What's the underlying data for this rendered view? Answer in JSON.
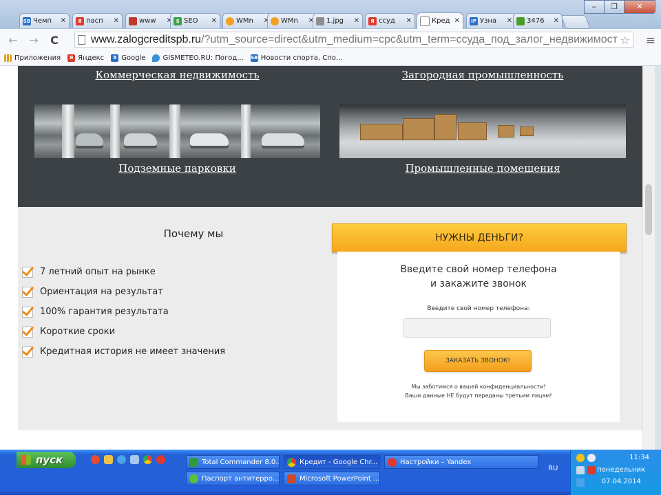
{
  "browser": {
    "tabs": [
      {
        "label": "Чемп",
        "fav": "SB",
        "color": "#2b6fc4"
      },
      {
        "label": "пасп",
        "fav": "Я",
        "color": "#e03a2a"
      },
      {
        "label": "www",
        "fav": "",
        "color": "#c0392b"
      },
      {
        "label": "SEO",
        "fav": "$",
        "color": "#3aa345"
      },
      {
        "label": "WMn",
        "fav": "",
        "color": "#f4a11d"
      },
      {
        "label": "WMn",
        "fav": "",
        "color": "#f4a11d"
      },
      {
        "label": "1.jpg",
        "fav": "",
        "color": "#8e8e8e"
      },
      {
        "label": "ссуд",
        "fav": "Я",
        "color": "#e03a2a"
      },
      {
        "label": "Кред",
        "fav": "",
        "color": "#ffffff"
      },
      {
        "label": "Узна",
        "fav": "IP",
        "color": "#2b6fc4"
      },
      {
        "label": "3476",
        "fav": "",
        "color": "#4a9c2e"
      }
    ],
    "active_tab_index": 8,
    "window_buttons": {
      "minimize": "‒",
      "maximize": "❐",
      "close": "✕"
    },
    "url_host": "www.zalogcreditspb.ru",
    "url_rest": "/?utm_source=direct&utm_medium=cpc&utm_term=ссуда_под_залог_недвижимости&utm_k",
    "bookmarks": [
      {
        "label": "Приложения",
        "fav": "",
        "color": "#e0a21b"
      },
      {
        "label": "Яндекс",
        "fav": "Я",
        "color": "#e03a2a"
      },
      {
        "label": "Google",
        "fav": "8",
        "color": "#2b6fc4"
      },
      {
        "label": "GISMETEO.RU: Погод...",
        "fav": "",
        "color": "#3a8fd9"
      },
      {
        "label": "Новости спорта, Спо...",
        "fav": "SB",
        "color": "#2b6fc4"
      }
    ]
  },
  "page": {
    "links": {
      "commercial": "Коммерческая недвижимость",
      "suburban": "Загородная промышленность",
      "parking": "Подземные парковки",
      "industrial": "Промышленные помещения"
    },
    "why_title": "Почему мы",
    "benefits": [
      "7 летний опыт на рынке",
      "Ориентация на результат",
      "100% гарантия результата",
      "Короткие сроки",
      "Кредитная история не имеет значения"
    ],
    "cta": {
      "banner": "НУЖНЫ ДЕНЬГИ?",
      "heading_line1": "Введите свой номер телефона",
      "heading_line2": "и закажите звонок",
      "field_label": "Введите свой номер телефона:",
      "phone_value": "",
      "button": "ЗАКАЗАТЬ ЗВОНОК!",
      "privacy_line1": "Мы заботимся о вашей конфиденциальности!",
      "privacy_line2": "Ваши данные НЕ будут переданы третьим лицам!"
    },
    "accent_color": "#f5a71d",
    "dark_bg": "#3c4145"
  },
  "taskbar": {
    "start_label": "пуск",
    "tasks": [
      {
        "label": "Total Commander 8.0...",
        "color": "#2f9c3a"
      },
      {
        "label": "Кредит - Google Chr...",
        "color": "#e0a21b"
      },
      {
        "label": "Настройки – Yandex",
        "color": "#e03a2a"
      },
      {
        "label": "Паспорт антитерро...",
        "color": "#5fbf3a"
      },
      {
        "label": "Microsoft PowerPoint ...",
        "color": "#d24726"
      }
    ],
    "language": "RU",
    "time": "11:34",
    "day": "понедельник",
    "date": "07.04.2014"
  }
}
